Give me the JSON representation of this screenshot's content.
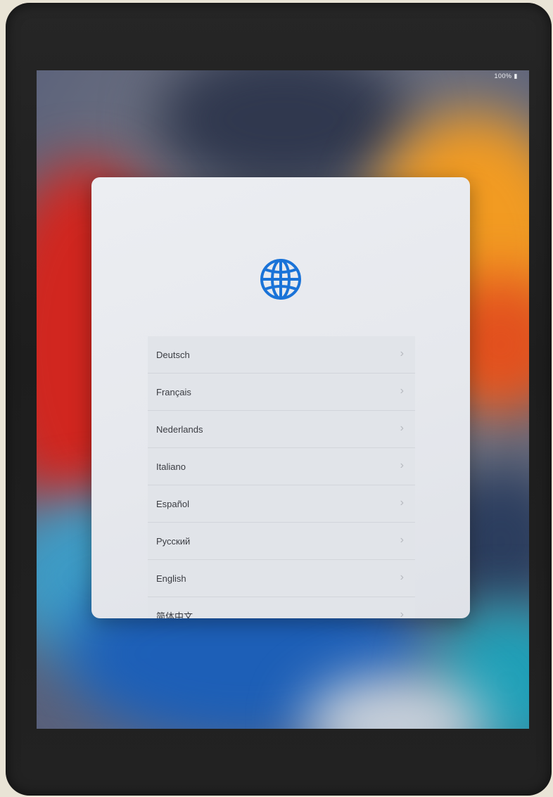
{
  "status_bar": {
    "battery_text": "100%"
  },
  "language_picker": {
    "icon": "globe-icon",
    "accent_color": "#1a73d8",
    "languages": [
      {
        "label": "Deutsch"
      },
      {
        "label": "Français"
      },
      {
        "label": "Nederlands"
      },
      {
        "label": "Italiano"
      },
      {
        "label": "Español"
      },
      {
        "label": "Русский"
      },
      {
        "label": "English"
      },
      {
        "label": "简体中文"
      }
    ],
    "chevron_glyph": "›"
  }
}
